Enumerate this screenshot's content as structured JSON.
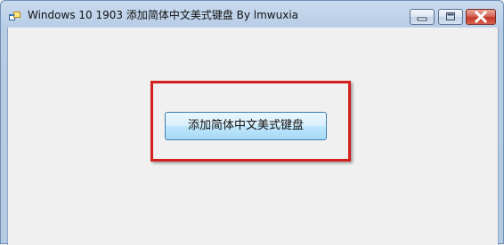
{
  "window": {
    "title": "Windows 10 1903 添加简体中文美式键盘 By lmwuxia",
    "icon": "app-window-icon",
    "controls": {
      "minimize": "minimize-icon",
      "maximize": "maximize-icon",
      "close": "close-icon"
    }
  },
  "main": {
    "add_keyboard_button_label": "添加简体中文美式键盘"
  },
  "colors": {
    "highlight_border": "#d42020",
    "button_border": "#3c7fb1",
    "client_background": "#f0f0f0"
  }
}
